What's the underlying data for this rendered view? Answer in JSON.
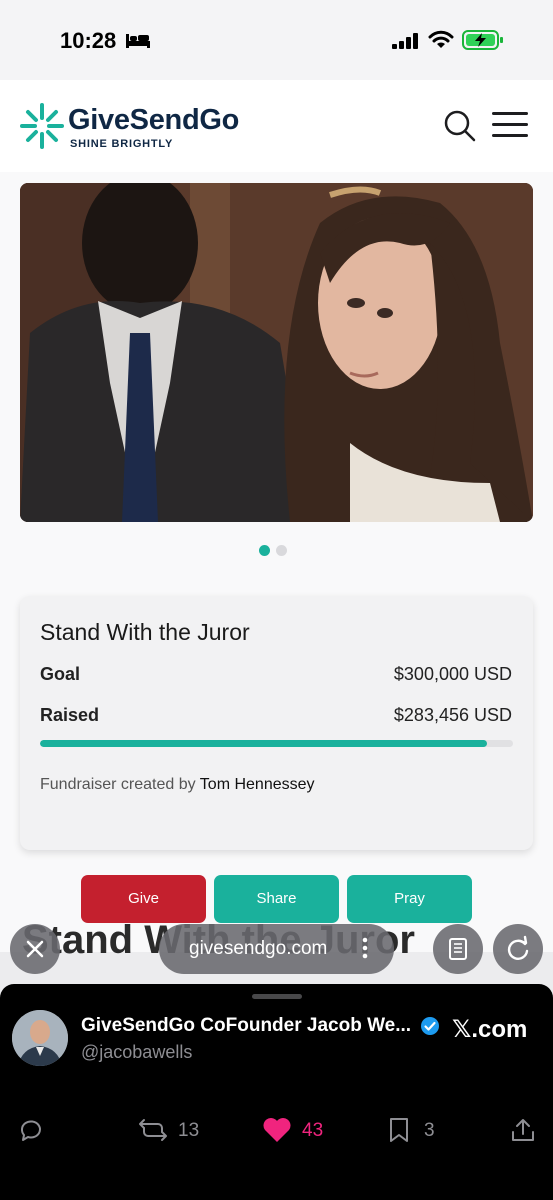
{
  "status_bar": {
    "time": "10:28"
  },
  "site": {
    "brand_name": "GiveSendGo",
    "tagline": "SHINE BRIGHTLY",
    "accent_color": "#1ab19c",
    "brand_color": "#0f2744"
  },
  "carousel": {
    "slides": 2,
    "active_index": 0
  },
  "campaign": {
    "title": "Stand With the Juror",
    "goal_label": "Goal",
    "goal_value": "$300,000 USD",
    "raised_label": "Raised",
    "raised_value": "$283,456 USD",
    "progress_fraction": 0.945,
    "created_by_prefix": "Fundraiser created by",
    "creator_name": "Tom Hennessey"
  },
  "actions": {
    "give_label": "Give",
    "share_label": "Share",
    "pray_label": "Pray",
    "give_color": "#c4202e"
  },
  "page_heading": "Stand With the Juror",
  "browser": {
    "url": "givesendgo.com"
  },
  "tweet": {
    "author_name": "GiveSendGo CoFounder Jacob We...",
    "handle": "@jacobawells",
    "source": "𝕏.com",
    "reposts": "13",
    "likes": "43",
    "bookmarks": "3",
    "like_color": "#f0247e"
  }
}
